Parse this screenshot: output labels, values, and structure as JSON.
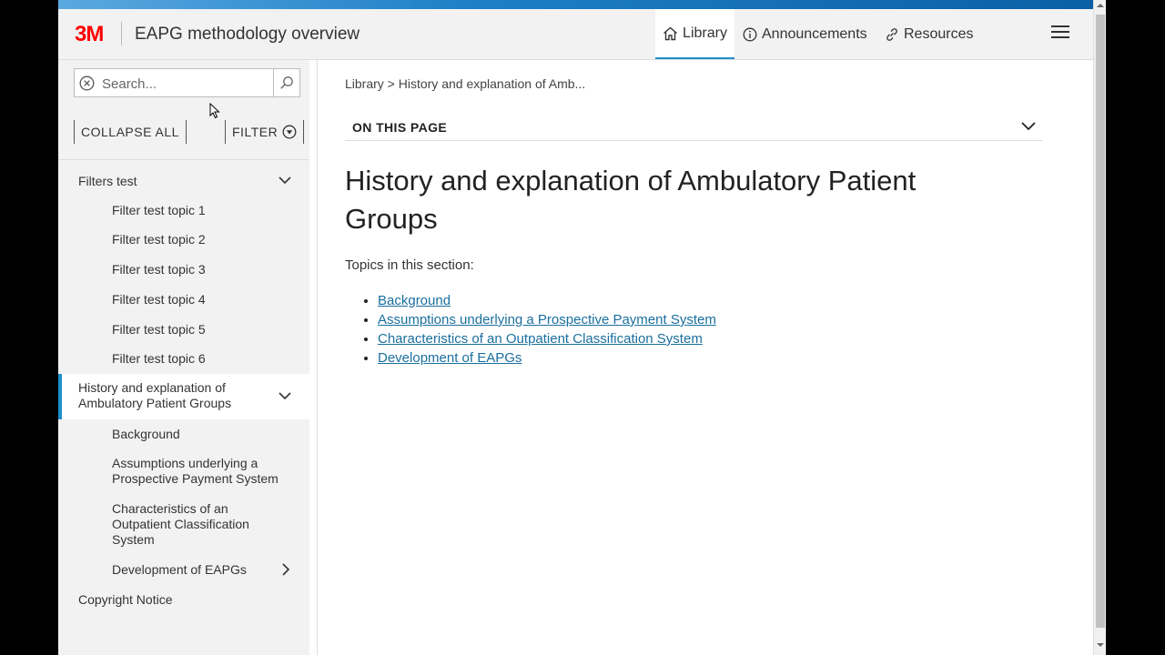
{
  "header": {
    "logo": "3M",
    "title": "EAPG methodology overview",
    "nav": [
      {
        "label": "Library",
        "icon": "home-icon"
      },
      {
        "label": "Announcements",
        "icon": "info-icon"
      },
      {
        "label": "Resources",
        "icon": "link-icon"
      }
    ],
    "menu_icon": "hamburger-menu-icon"
  },
  "sidebar": {
    "search_placeholder": "Search...",
    "collapse_all": "COLLAPSE ALL",
    "filter": "FILTER",
    "toc": [
      {
        "label": "Filters test",
        "expanded": true,
        "children": [
          "Filter test topic 1",
          "Filter test topic 2",
          "Filter test topic 3",
          "Filter test topic 4",
          "Filter test topic 5",
          "Filter test topic 6"
        ]
      },
      {
        "label": "History and explanation of Ambulatory Patient Groups",
        "expanded": true,
        "active": true,
        "children": [
          "Background",
          "Assumptions underlying a Prospective Payment System",
          "Characteristics of an Outpatient Classification System",
          "Development of EAPGs"
        ]
      },
      {
        "label": "Copyright Notice"
      }
    ]
  },
  "main": {
    "breadcrumb": "Library > History and explanation of Amb...",
    "on_this_page": "ON THIS PAGE",
    "title": "History and explanation of Ambulatory Patient Groups",
    "intro": "Topics in this section:",
    "topics": [
      "Background",
      "Assumptions underlying a Prospective Payment System",
      "Characteristics of an Outpatient Classification System",
      "Development of EAPGs"
    ]
  },
  "colors": {
    "accent": "#1e90c8",
    "brand_red": "#ff0000",
    "link": "#1a6f9e",
    "sidebar_bg": "#f2f2f2"
  }
}
